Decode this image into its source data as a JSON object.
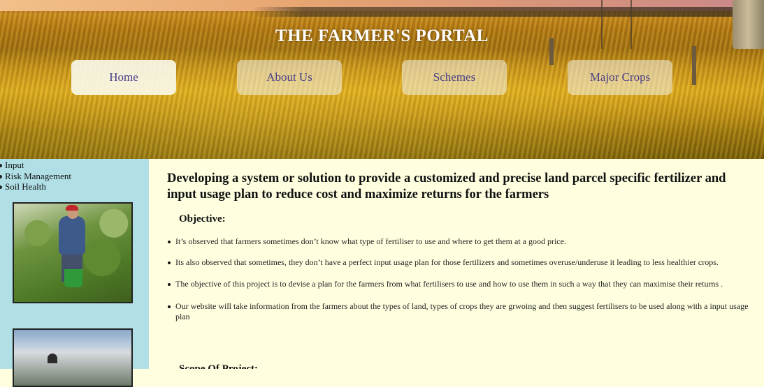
{
  "header": {
    "title": "THE FARMER'S PORTAL",
    "nav": [
      {
        "label": "Home",
        "active": true
      },
      {
        "label": "About Us",
        "active": false
      },
      {
        "label": "Schemes",
        "active": false
      },
      {
        "label": "Major Crops",
        "active": false
      }
    ]
  },
  "sidebar": {
    "items": [
      "Input",
      "Risk Management",
      "Soil Health"
    ]
  },
  "main": {
    "heading": "Developing a system or solution to provide a customized and precise land parcel specific fertilizer and input usage plan to reduce cost and maximize returns for the farmers",
    "objective_label": "Objective:",
    "points": [
      "It’s observed that farmers sometimes don’t know what type of fertiliser to use and where to get them at a good price.",
      "Its also observed that sometimes, they don’t have a perfect input usage plan for those fertilizers and sometimes overuse/underuse it leading to less healthier crops.",
      "The objective of this project is to devise a plan for the farmers from what fertilisers to use and how to use them in such a way that they can maximise their returns .",
      "Our website will take information from the farmers about the types of land, types of crops they are grwoing and then suggest fertilisers to be used along with a input usage plan"
    ],
    "next_section_label": "Scope Of Project:"
  },
  "colors": {
    "sidebar_bg": "#b0e0e6",
    "main_bg": "#ffffe0",
    "nav_text": "#4b3f8a",
    "title_text": "#ffffff"
  }
}
